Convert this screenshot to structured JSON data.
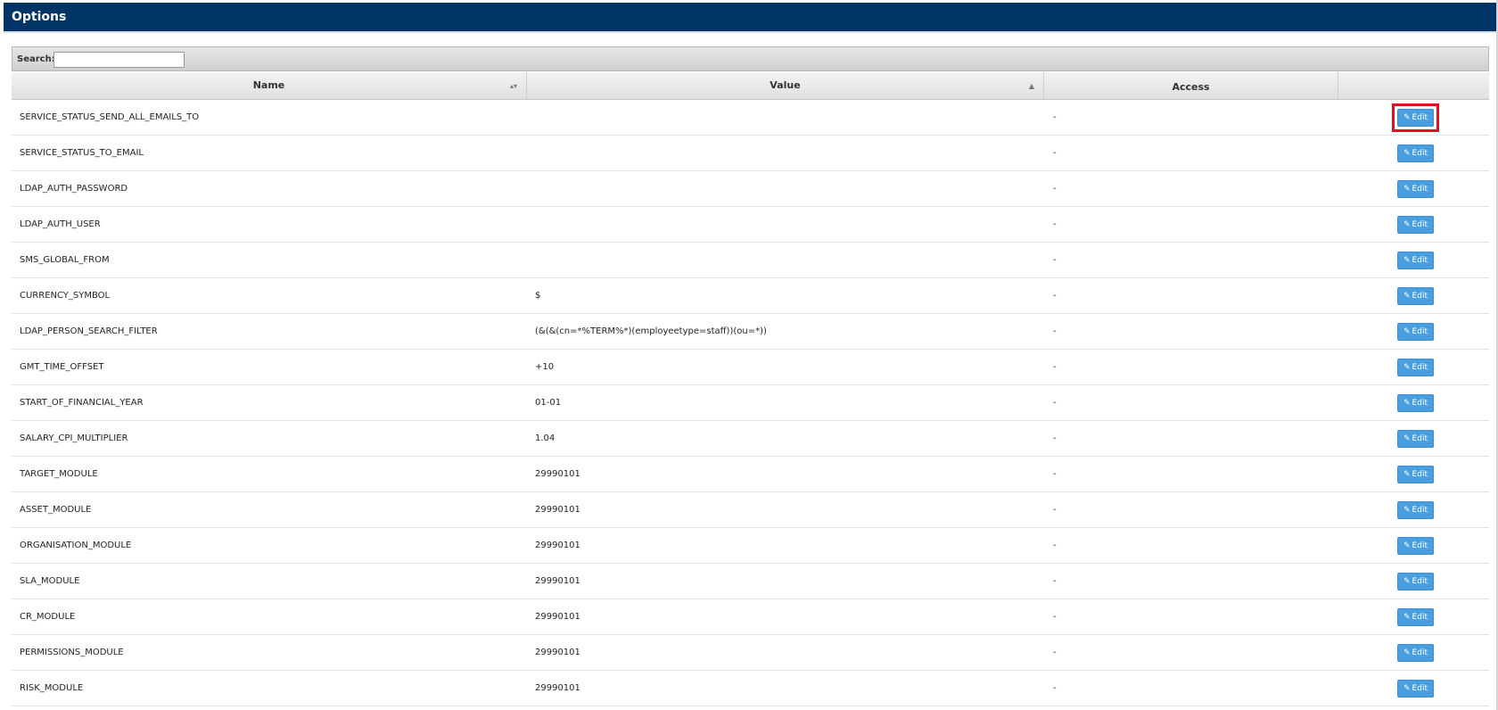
{
  "header": {
    "title": "Options"
  },
  "search": {
    "label": "Search:",
    "value": "",
    "placeholder": ""
  },
  "columns": {
    "name": "Name",
    "value": "Value",
    "access": "Access",
    "actions": ""
  },
  "edit_label": "Edit",
  "icons": {
    "edit": "pencil-icon",
    "sort_name": "sort-both-icon",
    "sort_value": "sort-asc-icon"
  },
  "rows": [
    {
      "name": "SERVICE_STATUS_SEND_ALL_EMAILS_TO",
      "value": "",
      "access": "-",
      "highlighted": true
    },
    {
      "name": "SERVICE_STATUS_TO_EMAIL",
      "value": "",
      "access": "-"
    },
    {
      "name": "LDAP_AUTH_PASSWORD",
      "value": "",
      "access": "-"
    },
    {
      "name": "LDAP_AUTH_USER",
      "value": "",
      "access": "-"
    },
    {
      "name": "SMS_GLOBAL_FROM",
      "value": "",
      "access": "-"
    },
    {
      "name": "CURRENCY_SYMBOL",
      "value": "$",
      "access": "-"
    },
    {
      "name": "LDAP_PERSON_SEARCH_FILTER",
      "value": "(&(&(cn=*%TERM%*)(employeetype=staff))(ou=*))",
      "access": "-"
    },
    {
      "name": "GMT_TIME_OFFSET",
      "value": "+10",
      "access": "-"
    },
    {
      "name": "START_OF_FINANCIAL_YEAR",
      "value": "01-01",
      "access": "-"
    },
    {
      "name": "SALARY_CPI_MULTIPLIER",
      "value": "1.04",
      "access": "-"
    },
    {
      "name": "TARGET_MODULE",
      "value": "29990101",
      "access": "-"
    },
    {
      "name": "ASSET_MODULE",
      "value": "29990101",
      "access": "-"
    },
    {
      "name": "ORGANISATION_MODULE",
      "value": "29990101",
      "access": "-"
    },
    {
      "name": "SLA_MODULE",
      "value": "29990101",
      "access": "-"
    },
    {
      "name": "CR_MODULE",
      "value": "29990101",
      "access": "-"
    },
    {
      "name": "PERMISSIONS_MODULE",
      "value": "29990101",
      "access": "-"
    },
    {
      "name": "RISK_MODULE",
      "value": "29990101",
      "access": "-"
    }
  ],
  "colors": {
    "header_bg": "#003366",
    "edit_button": "#4a9fe0",
    "highlight": "#e0111b"
  }
}
